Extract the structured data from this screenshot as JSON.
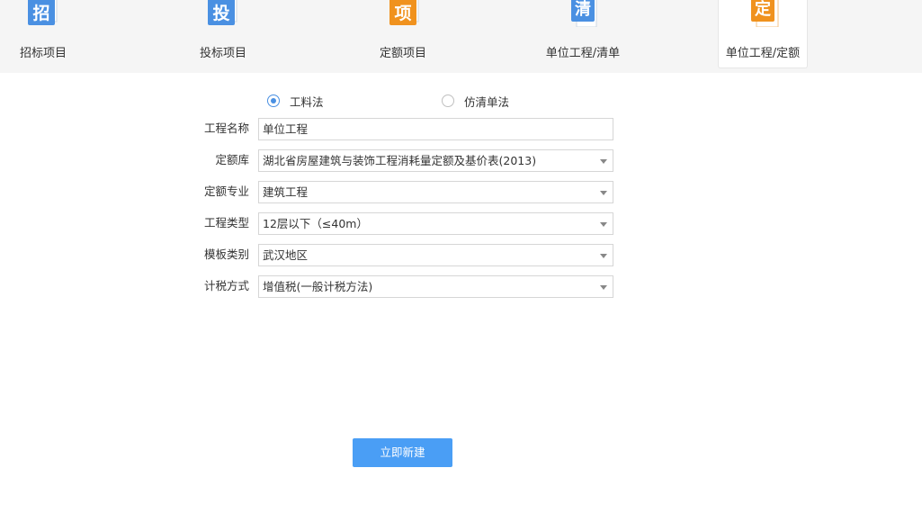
{
  "tabs": [
    {
      "label": "招标项目",
      "icon_char": "招",
      "icon": "bid-invite-icon",
      "color": "#4a90e2"
    },
    {
      "label": "投标项目",
      "icon_char": "投",
      "icon": "bid-submit-icon",
      "color": "#4a90e2"
    },
    {
      "label": "定额项目",
      "icon_char": "项",
      "icon": "quota-project-icon",
      "color": "#f0921e"
    },
    {
      "label": "单位工程/清单",
      "icon_char": "清",
      "icon": "bill-list-icon",
      "color": "#4a90e2"
    },
    {
      "label": "单位工程/定额",
      "icon_char": "定",
      "icon": "quota-icon",
      "color": "#f0921e",
      "active": true
    }
  ],
  "method": {
    "option1": "工料法",
    "option2": "仿清单法",
    "selected": "工料法"
  },
  "form": {
    "project_name": {
      "label": "工程名称",
      "value": "单位工程"
    },
    "quota_library": {
      "label": "定额库",
      "value": "湖北省房屋建筑与装饰工程消耗量定额及基价表(2013)"
    },
    "quota_specialty": {
      "label": "定额专业",
      "value": "建筑工程"
    },
    "project_type": {
      "label": "工程类型",
      "value": "12层以下（≤40m）"
    },
    "template_category": {
      "label": "模板类别",
      "value": "武汉地区"
    },
    "tax_method": {
      "label": "计税方式",
      "value": "增值税(一般计税方法)"
    }
  },
  "create_button": "立即新建",
  "colors": {
    "accent": "#4a90e2",
    "orange": "#f0921e",
    "button": "#4a9ef5"
  }
}
